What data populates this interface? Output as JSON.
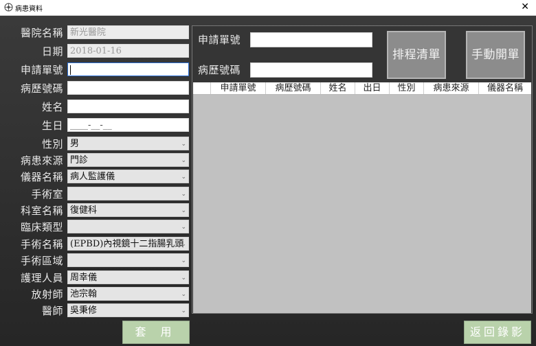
{
  "window": {
    "title": "病患資料",
    "close": "✕"
  },
  "form": {
    "hospital": {
      "label": "醫院名稱",
      "value": "新光醫院"
    },
    "date": {
      "label": "日期",
      "value": "2018-01-16"
    },
    "request_no": {
      "label": "申請單號",
      "value": ""
    },
    "chart_no": {
      "label": "病歷號碼",
      "value": ""
    },
    "name": {
      "label": "姓名",
      "value": ""
    },
    "birthday": {
      "label": "生日",
      "value": "____-__-__"
    },
    "gender": {
      "label": "性別",
      "value": "男"
    },
    "patient_source": {
      "label": "病患來源",
      "value": "門診"
    },
    "device_name": {
      "label": "儀器名稱",
      "value": "病人監護儀"
    },
    "operating_room": {
      "label": "手術室",
      "value": ""
    },
    "department": {
      "label": "科室名稱",
      "value": "復健科"
    },
    "clinical_type": {
      "label": "臨床類型",
      "value": ""
    },
    "surgery_name": {
      "label": "手術名稱",
      "value": "(EPBD)內視鏡十二指腸乳頭"
    },
    "surgery_area": {
      "label": "手術區域",
      "value": ""
    },
    "nurse": {
      "label": "護理人員",
      "value": "周幸儀"
    },
    "radiologist": {
      "label": "放射師",
      "value": "池宗翰"
    },
    "physician": {
      "label": "醫師",
      "value": "吳秉修"
    }
  },
  "search": {
    "request_no_label": "申請單號",
    "chart_no_label": "病歷號碼",
    "schedule_button": "排程清單",
    "manual_button": "手動開單"
  },
  "table": {
    "columns": [
      "申請單號",
      "病歷號碼",
      "姓名",
      "出日",
      "性別",
      "病患來源",
      "儀器名稱"
    ]
  },
  "footer": {
    "apply_button": "套 用",
    "return_button": "返回錄影"
  }
}
